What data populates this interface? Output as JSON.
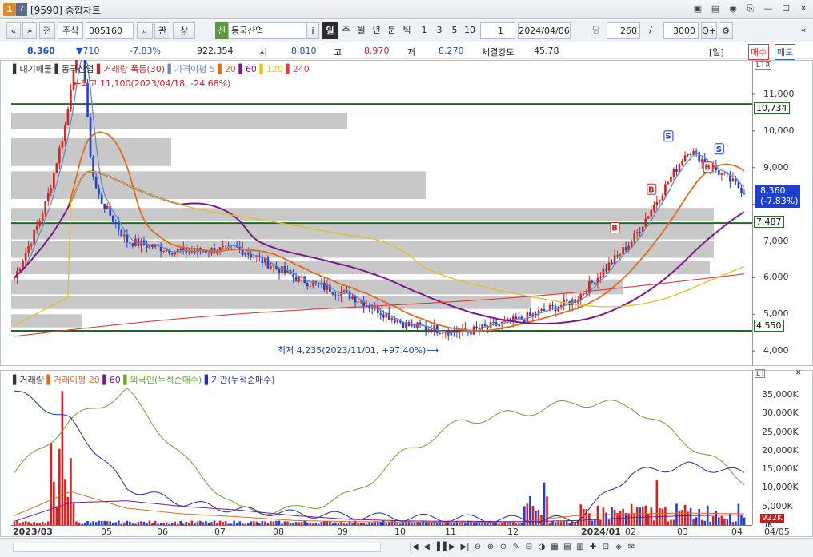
{
  "window": {
    "badge": "1",
    "badge2": "?",
    "title": "[9590] 종합차트",
    "buttons": [
      "▣",
      "▤",
      "◉",
      "⎘",
      "—",
      "☐",
      "✕"
    ]
  },
  "toolbar": {
    "nav_prev": "«",
    "nav_down": "»",
    "jeon": "전",
    "market_select": "주식",
    "code": "005160",
    "search": "⌕",
    "gwan": "관",
    "sang": "상",
    "shin": "신",
    "name": "동국산업",
    "info": "i",
    "periods": [
      "일",
      "주",
      "월",
      "년",
      "분",
      "틱"
    ],
    "intervals": [
      "1",
      "3",
      "5",
      "10"
    ],
    "interval_value": "1",
    "date": "2024/04/06",
    "dang": "당",
    "count": "260",
    "slash": "/",
    "total": "3000",
    "zoom": "Q+",
    "settings": "⚙",
    "right_arrow": "«"
  },
  "quote": {
    "price": "8,360",
    "change": "▼710",
    "change_pct": "-7.83%",
    "volume": "922,354",
    "open_label": "시",
    "open": "8,810",
    "high_label": "고",
    "high": "8,970",
    "low_label": "저",
    "low": "8,270",
    "strength_label": "체결강도",
    "strength": "45.78",
    "period_tag": "[일]",
    "buy": "매수",
    "sell": "매도"
  },
  "price_legend": {
    "items": [
      {
        "text": "▌대기매물",
        "color": "#333333"
      },
      {
        "text": "▌동국산업",
        "color": "#333333"
      },
      {
        "text": "▌거래량 폭등(30)",
        "color": "#b03030"
      },
      {
        "text": "▌가격이평 5",
        "color": "#6a8ac0"
      },
      {
        "text": "▌20",
        "color": "#e06a20"
      },
      {
        "text": "▌60",
        "color": "#7a1a8a"
      },
      {
        "text": "▌120",
        "color": "#e0c020"
      },
      {
        "text": "▌240",
        "color": "#e03a3a"
      }
    ],
    "corner": "L I R"
  },
  "annotations": {
    "high": "←최고 11,100(2023/04/18, -24.68%)",
    "low": "최저 4,235(2023/11/01, +97.40%)⟶"
  },
  "price_axis": {
    "ticks": [
      "11,000",
      "10,000",
      "9,000",
      "8,000",
      "7,000",
      "6,000",
      "5,000",
      "4,000"
    ],
    "levels": {
      "upper": "10,734",
      "middle": "7,487",
      "lower": "4,550"
    },
    "current": "8,360",
    "current_pct": "(-7.83%)"
  },
  "volume_legend": {
    "items": [
      {
        "text": "▌거래량",
        "color": "#333333"
      },
      {
        "text": "▌거래이평 20",
        "color": "#e06a20"
      },
      {
        "text": "▌60",
        "color": "#7a1a8a"
      },
      {
        "text": "▌외국인(누적순매수)",
        "color": "#6aa030"
      },
      {
        "text": "▌기관(누적순매수)",
        "color": "#2030a0"
      }
    ],
    "corner": "L I"
  },
  "volume_axis": {
    "ticks": [
      "35,000K",
      "30,000K",
      "25,000K",
      "20,000K",
      "15,000K",
      "10,000K",
      "5,000K",
      "0K"
    ],
    "current": "922K"
  },
  "time_axis": {
    "labels": [
      "2023/03",
      "05",
      "06",
      "07",
      "08",
      "09",
      "10",
      "11",
      "12",
      "2024/01",
      "02",
      "03",
      "04"
    ],
    "corner": "04/05"
  },
  "chart_data": {
    "type": "candlestick",
    "title": "동국산업",
    "price_range": [
      3700,
      11500
    ],
    "volume_range": [
      0,
      38000
    ],
    "monthly_close": [
      {
        "x": "2023/03",
        "value": 6000
      },
      {
        "x": "2023/04",
        "value": 9400
      },
      {
        "x": "2023/05",
        "value": 7000
      },
      {
        "x": "2023/06",
        "value": 6700
      },
      {
        "x": "2023/07",
        "value": 6800
      },
      {
        "x": "2023/08",
        "value": 6000
      },
      {
        "x": "2023/09",
        "value": 5500
      },
      {
        "x": "2023/10",
        "value": 4700
      },
      {
        "x": "2023/11",
        "value": 4500
      },
      {
        "x": "2023/12",
        "value": 4850
      },
      {
        "x": "2024/01",
        "value": 5400
      },
      {
        "x": "2024/02",
        "value": 7000
      },
      {
        "x": "2024/03",
        "value": 9500
      },
      {
        "x": "2024/04",
        "value": 8360
      }
    ],
    "horizontal_levels": [
      10734,
      7487,
      4550
    ],
    "high": {
      "value": 11100,
      "date": "2023/04/18"
    },
    "low": {
      "value": 4235,
      "date": "2023/11/01"
    },
    "series": [
      {
        "name": "가격이평 5"
      },
      {
        "name": "20"
      },
      {
        "name": "60"
      },
      {
        "name": "120"
      },
      {
        "name": "240"
      }
    ]
  },
  "statusbar": {
    "buttons": [
      "|◀",
      "◀",
      "▐▐",
      "▶",
      "▶|",
      "⊖",
      "⊕",
      "⊙",
      "✎",
      "⊟",
      "◑",
      "▦",
      "▤",
      "▥",
      "✚",
      "⊡",
      "◈",
      "✉"
    ]
  }
}
